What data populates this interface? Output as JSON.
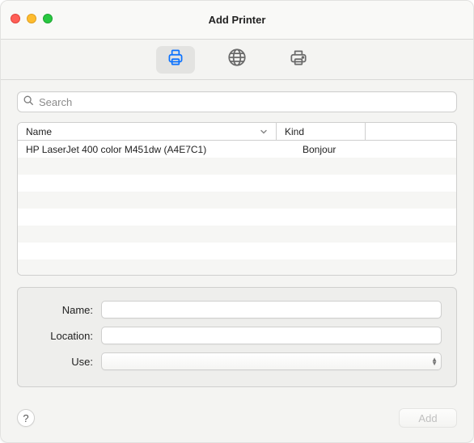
{
  "window": {
    "title": "Add Printer"
  },
  "tabs": {
    "default_selected": true,
    "ip_selected": false,
    "windows_selected": false
  },
  "search": {
    "placeholder": "Search",
    "value": ""
  },
  "table": {
    "columns": {
      "name": "Name",
      "kind": "Kind"
    },
    "rows": [
      {
        "name": "HP LaserJet 400 color M451dw (A4E7C1)",
        "kind": "Bonjour"
      }
    ]
  },
  "form": {
    "labels": {
      "name": "Name:",
      "location": "Location:",
      "use": "Use:"
    },
    "values": {
      "name": "",
      "location": "",
      "use": ""
    }
  },
  "footer": {
    "help": "?",
    "add_label": "Add",
    "add_enabled": false
  }
}
